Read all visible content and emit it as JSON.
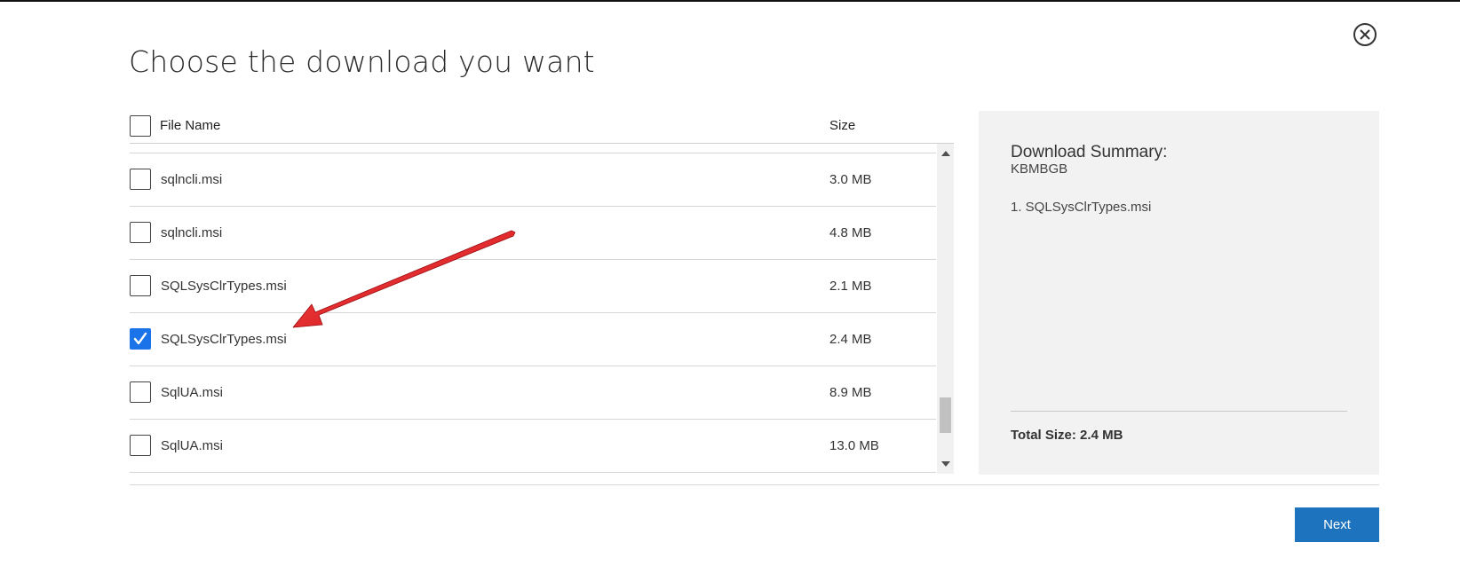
{
  "dialog": {
    "title": "Choose the download you want",
    "close_icon": "close-circle-icon"
  },
  "table": {
    "header": {
      "file_name": "File Name",
      "size": "Size",
      "select_all_checked": false
    },
    "rows": [
      {
        "name": "sqlncli.msi",
        "size": "3.0 MB",
        "checked": false
      },
      {
        "name": "sqlncli.msi",
        "size": "4.8 MB",
        "checked": false
      },
      {
        "name": "SQLSysClrTypes.msi",
        "size": "2.1 MB",
        "checked": false
      },
      {
        "name": "SQLSysClrTypes.msi",
        "size": "2.4 MB",
        "checked": true
      },
      {
        "name": "SqlUA.msi",
        "size": "8.9 MB",
        "checked": false
      },
      {
        "name": "SqlUA.msi",
        "size": "13.0 MB",
        "checked": false
      }
    ]
  },
  "summary": {
    "title": "Download Summary:",
    "kb": "KBMBGB",
    "items": [
      "1. SQLSysClrTypes.msi"
    ],
    "total_label": "Total Size: 2.4 MB"
  },
  "footer": {
    "next_label": "Next"
  },
  "colors": {
    "accent": "#1e73be",
    "checkbox_checked": "#1a73e8",
    "annotation_arrow": "#e0141a"
  }
}
